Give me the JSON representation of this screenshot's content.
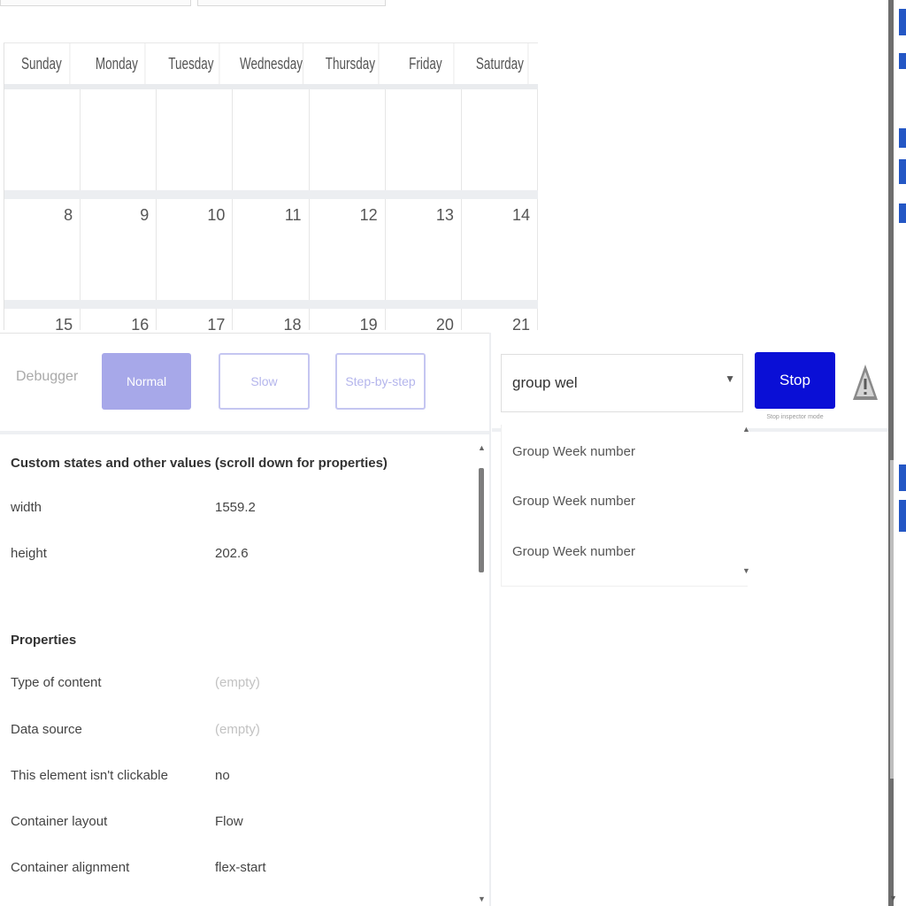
{
  "calendar": {
    "days": [
      "Sunday",
      "Monday",
      "Tuesday",
      "Wednesday",
      "Thursday",
      "Friday",
      "Saturday"
    ],
    "weeks": [
      [
        "",
        "",
        "",
        "",
        "",
        "",
        ""
      ],
      [
        "8",
        "9",
        "10",
        "11",
        "12",
        "13",
        "14"
      ],
      [
        "15",
        "16",
        "17",
        "18",
        "19",
        "20",
        "21"
      ]
    ]
  },
  "debugger": {
    "label": "Debugger",
    "normal": "Normal",
    "slow": "Slow",
    "step": "Step-by-step"
  },
  "inspector": {
    "custom_title": "Custom states and other values (scroll down for properties)",
    "width_label": "width",
    "width_value": "1559.2",
    "height_label": "height",
    "height_value": "202.6",
    "properties_title": "Properties",
    "type_label": "Type of content",
    "type_value": "(empty)",
    "source_label": "Data source",
    "source_value": "(empty)",
    "clickable_label": "This element isn't clickable",
    "clickable_value": "no",
    "layout_label": "Container layout",
    "layout_value": "Flow",
    "alignment_label": "Container alignment",
    "alignment_value": "flex-start"
  },
  "search": {
    "value": "group wel",
    "stop_label": "Stop",
    "stop_hint": "Stop inspector mode",
    "results": [
      "Group Week number",
      "Group Week number",
      "Group Week number"
    ]
  },
  "icons": {
    "warning": "warning-triangle-icon",
    "dropdown": "chevron-down-icon"
  },
  "colors": {
    "primary": "#0a0fd6",
    "normal_button": "#a7a8e9",
    "outline_button": "#c5c6f1"
  }
}
